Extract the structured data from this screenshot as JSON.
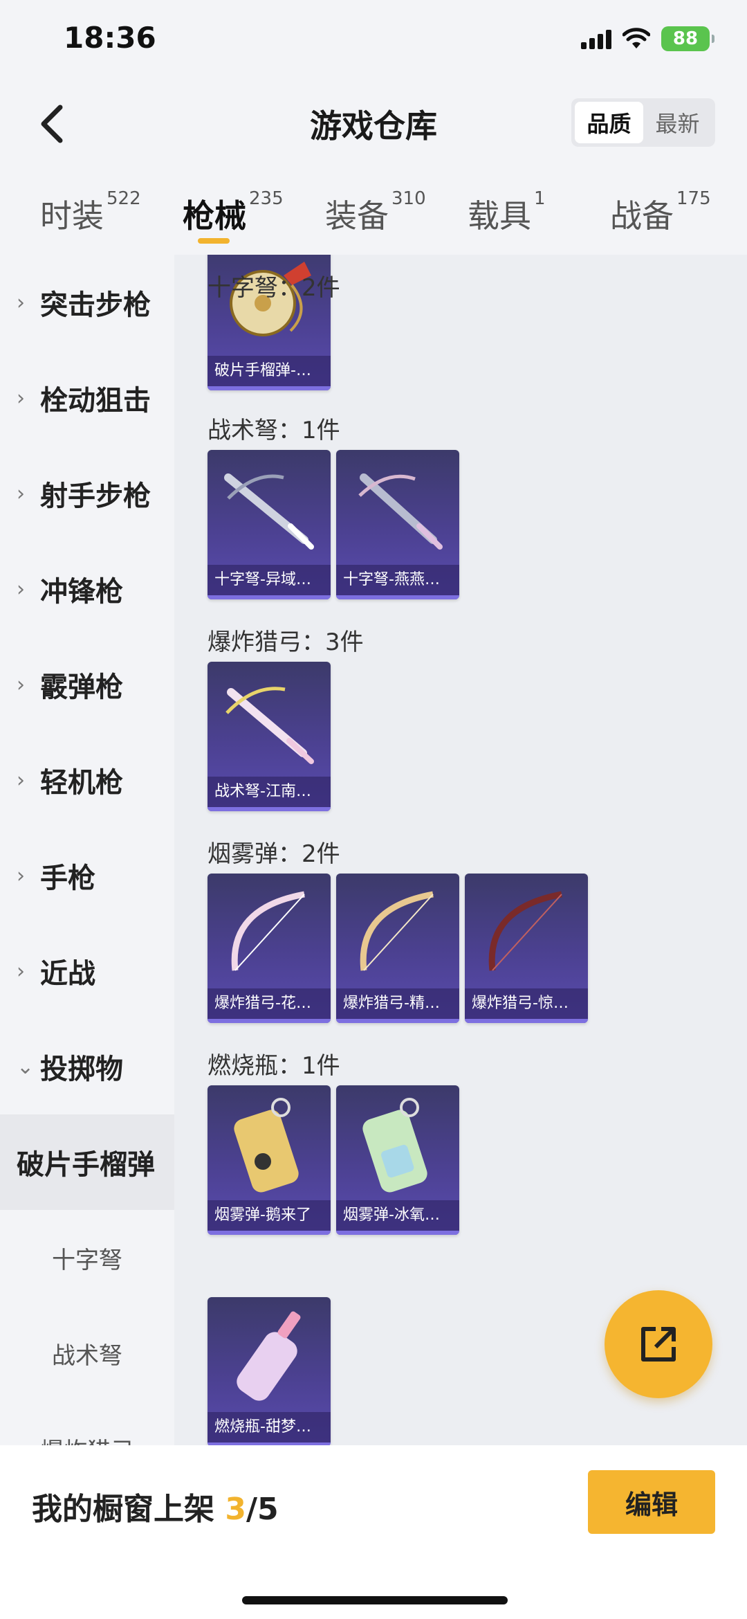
{
  "status": {
    "time": "18:36",
    "battery": "88"
  },
  "header": {
    "title": "游戏仓库",
    "sort_quality": "品质",
    "sort_newest": "最新"
  },
  "tabs": [
    {
      "label": "时装",
      "count": "522"
    },
    {
      "label": "枪械",
      "count": "235"
    },
    {
      "label": "装备",
      "count": "310"
    },
    {
      "label": "载具",
      "count": "1"
    },
    {
      "label": "战备",
      "count": "175"
    }
  ],
  "sidebar": {
    "items": [
      {
        "label": "突击步枪",
        "arrow": "›"
      },
      {
        "label": "栓动狙击",
        "arrow": "›"
      },
      {
        "label": "射手步枪",
        "arrow": "›"
      },
      {
        "label": "冲锋枪",
        "arrow": "›"
      },
      {
        "label": "霰弹枪",
        "arrow": "›"
      },
      {
        "label": "轻机枪",
        "arrow": "›"
      },
      {
        "label": "手枪",
        "arrow": "›"
      },
      {
        "label": "近战",
        "arrow": "›"
      },
      {
        "label": "投掷物",
        "arrow": "⌄"
      }
    ],
    "active": "破片手榴弹",
    "sub": [
      "十字弩",
      "战术弩",
      "爆炸猎弓"
    ]
  },
  "groups": [
    {
      "title": "",
      "items": [
        "破片手榴弹-…"
      ]
    },
    {
      "title": "十字弩：2件",
      "items": [
        "十字弩-异域…",
        "十字弩-燕燕…"
      ]
    },
    {
      "title": "战术弩：1件",
      "items": [
        "战术弩-江南…"
      ]
    },
    {
      "title": "爆炸猎弓：3件",
      "items": [
        "爆炸猎弓-花…",
        "爆炸猎弓-精…",
        "爆炸猎弓-惊…"
      ]
    },
    {
      "title": "烟雾弹：2件",
      "items": [
        "烟雾弹-鹅来了",
        "烟雾弹-冰氧…"
      ]
    },
    {
      "title": "燃烧瓶：1件",
      "items": [
        "燃烧瓶-甜梦…"
      ]
    }
  ],
  "bottom": {
    "shelf_label": "我的橱窗上架 ",
    "shelf_current": "3",
    "shelf_total": "/5",
    "edit": "编辑"
  },
  "colors": {
    "accent": "#f5b530",
    "card_bg": "#4c4192"
  }
}
